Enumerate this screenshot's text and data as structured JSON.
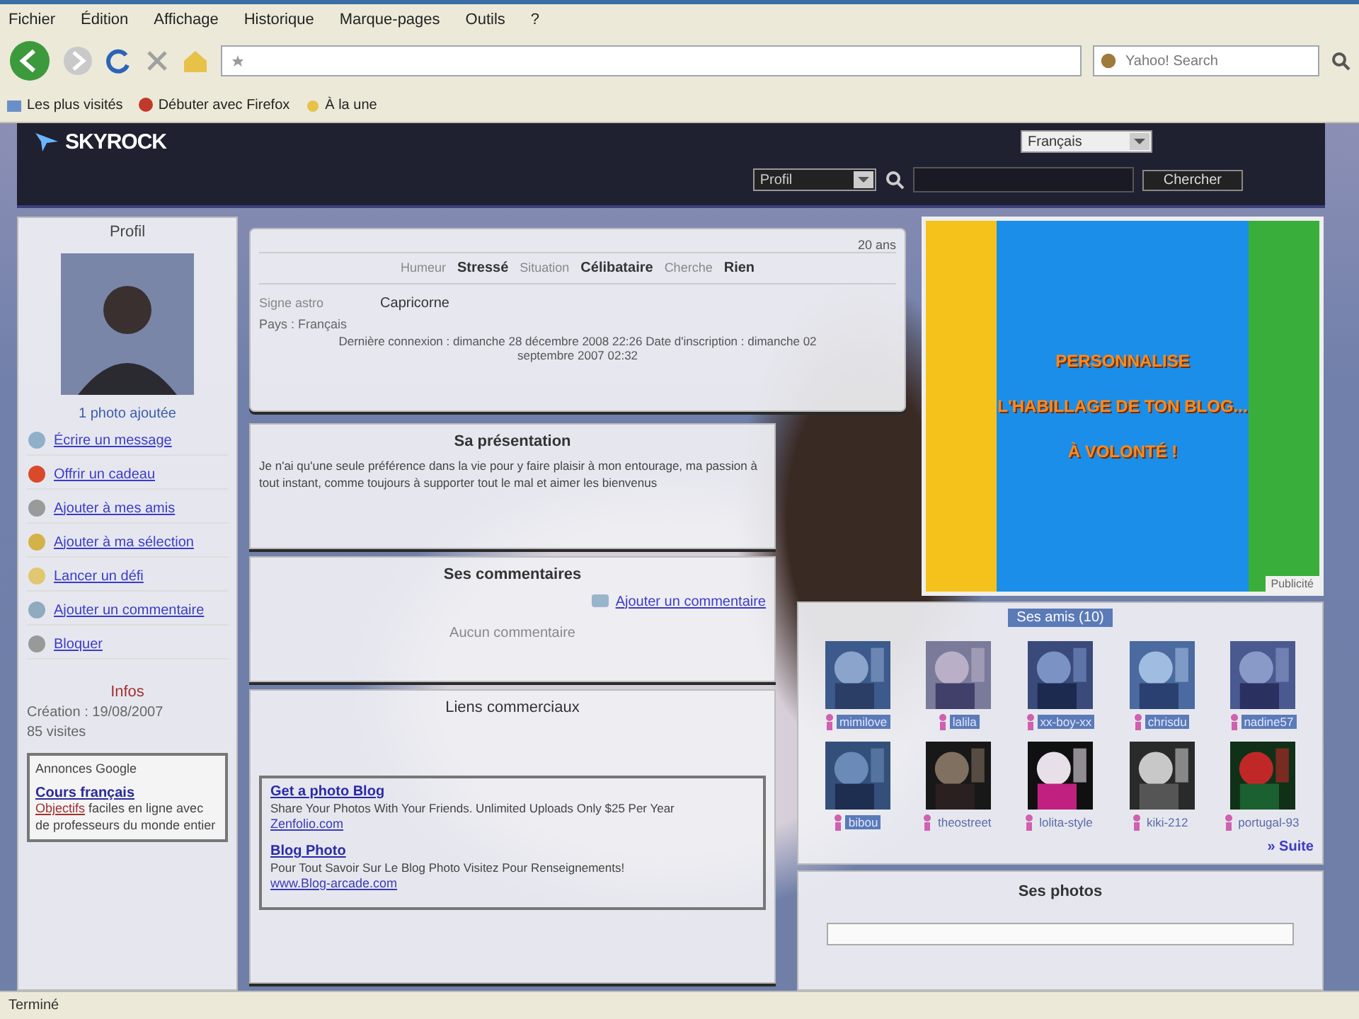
{
  "browser": {
    "menu": [
      "Fichier",
      "Édition",
      "Affichage",
      "Historique",
      "Marque-pages",
      "Outils",
      "?"
    ],
    "search_placeholder": "Yahoo! Search",
    "bookmarks": [
      "Les plus visités",
      "Débuter avec Firefox",
      "À la une"
    ]
  },
  "site": {
    "logo": "SKYROCK",
    "language": "Français",
    "search_scope": "Profil",
    "search_button": "Chercher"
  },
  "sidebar": {
    "title": "Profil",
    "photo_count": "1 photo ajoutée",
    "actions": [
      "Écrire un message",
      "Offrir un cadeau",
      "Ajouter à mes amis",
      "Ajouter à ma sélection",
      "Lancer un défi",
      "Ajouter un commentaire",
      "Bloquer"
    ],
    "infos_title": "Infos",
    "infos": [
      "Création : 19/08/2007",
      "85 visites"
    ],
    "ad": {
      "title": "Annonces Google",
      "link": "Cours français",
      "link2": "Objectifs",
      "text": "faciles en ligne avec de professeurs du monde entier"
    }
  },
  "profile": {
    "age": "20 ans",
    "fields": [
      {
        "label": "Humeur",
        "value": "Stressé"
      },
      {
        "label": "Situation",
        "value": "Célibataire"
      },
      {
        "label": "Cherche",
        "value": "Rien"
      }
    ],
    "sign_label": "Signe astro",
    "sign": "Capricorne",
    "country": "Pays : Français",
    "dates": "Dernière connexion : dimanche 28 décembre 2008 22:26 Date d'inscription : dimanche 02 septembre 2007 02:32"
  },
  "presentation": {
    "title": "Sa présentation",
    "text": "Je n'ai qu'une seule préférence dans la vie pour y faire plaisir à mon entourage, ma passion à tout instant, comme toujours à supporter tout le mal et aimer les bienvenus"
  },
  "comments": {
    "title": "Ses commentaires",
    "add": "Ajouter un commentaire",
    "empty": "Aucun commentaire"
  },
  "sponsored": {
    "title": "Liens commerciaux",
    "ads": [
      {
        "title": "Get a photo Blog",
        "text": "Share Your Photos With Your Friends. Unlimited Uploads Only $25 Per Year",
        "url": "Zenfolio.com"
      },
      {
        "title": "Blog Photo",
        "text": "Pour Tout Savoir Sur Le Blog Photo Visitez Pour Renseignements!",
        "url": "www.Blog-arcade.com"
      }
    ]
  },
  "banner": {
    "lines": [
      "PERSONNALISE",
      "L'HABILLAGE DE TON BLOG...",
      "À VOLONTÉ !"
    ],
    "caption": "Publicité"
  },
  "friends": {
    "title": "Ses amis (10)",
    "more": "» Suite",
    "items": [
      {
        "name": "mimilove",
        "highlighted": true
      },
      {
        "name": "lalila",
        "highlighted": true
      },
      {
        "name": "xx-boy-xx",
        "highlighted": true
      },
      {
        "name": "chrisdu",
        "highlighted": true
      },
      {
        "name": "nadine57",
        "highlighted": true
      },
      {
        "name": "bibou",
        "highlighted": true
      },
      {
        "name": "theostreet",
        "highlighted": false
      },
      {
        "name": "lolita-style",
        "highlighted": false
      },
      {
        "name": "kiki-212",
        "highlighted": false
      },
      {
        "name": "portugal-93",
        "highlighted": false
      }
    ]
  },
  "photos": {
    "title": "Ses photos"
  },
  "status_bar": "Terminé"
}
